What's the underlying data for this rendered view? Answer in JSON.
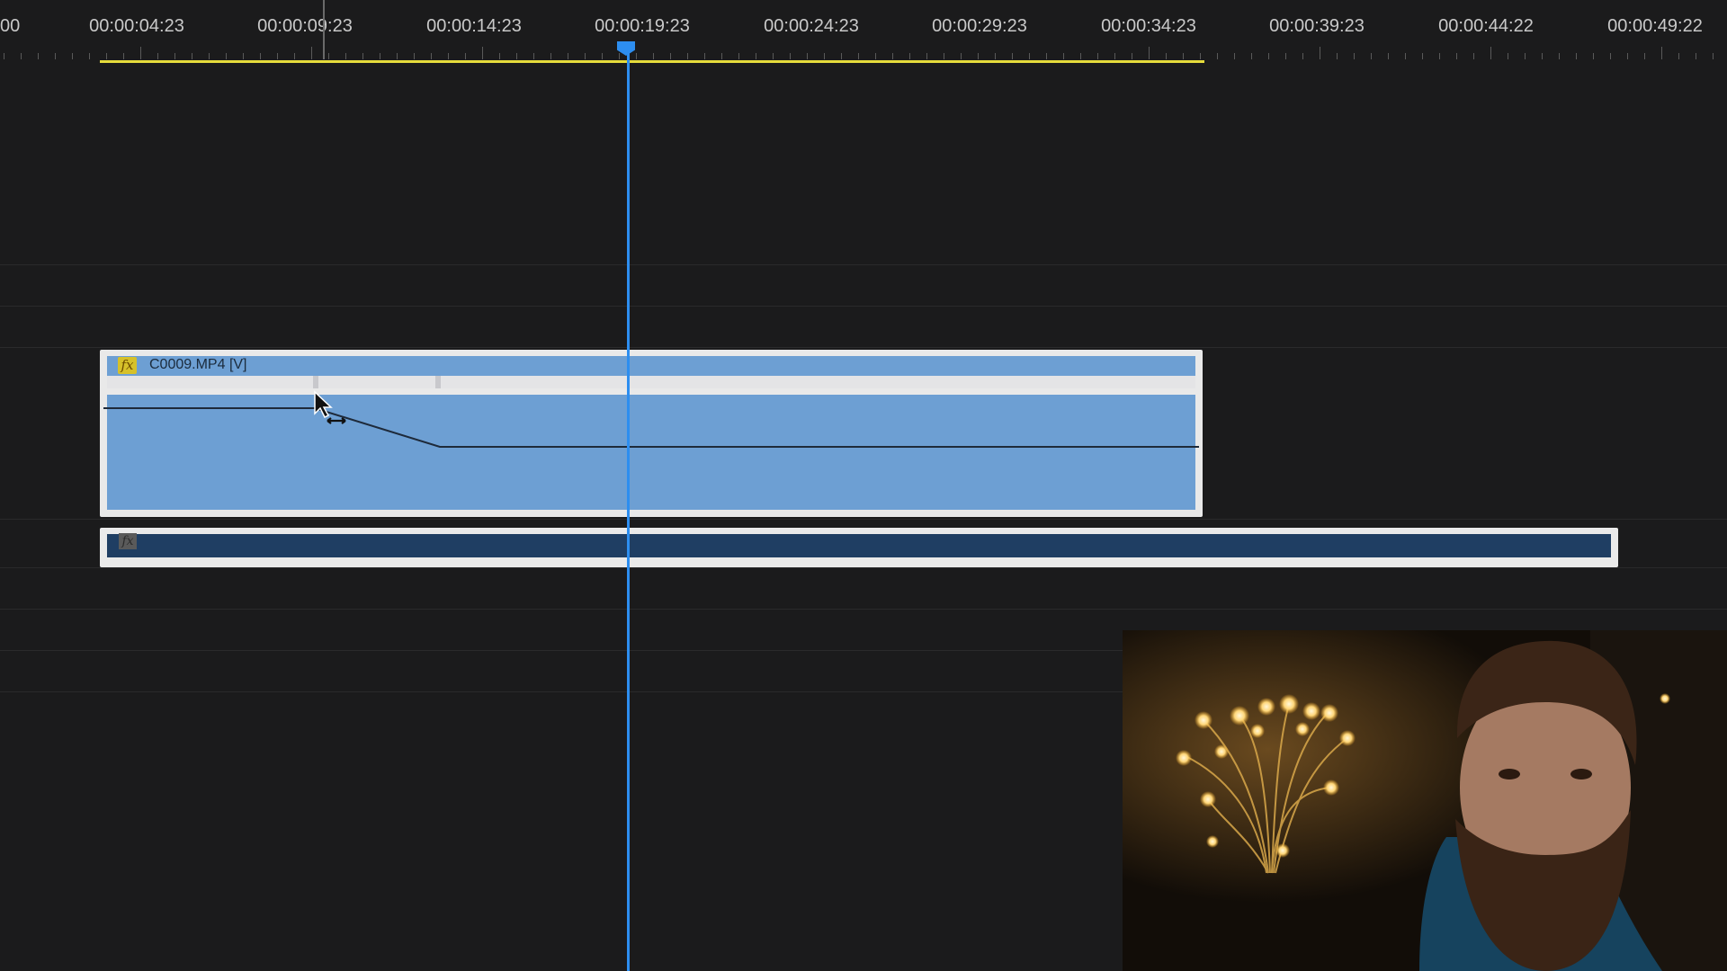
{
  "ruler": {
    "timecodes": [
      "00",
      "00:00:04:23",
      "00:00:09:23",
      "00:00:14:23",
      "00:00:19:23",
      "00:00:24:23",
      "00:00:29:23",
      "00:00:34:23",
      "00:00:39:23",
      "00:00:44:22",
      "00:00:49:22"
    ]
  },
  "playhead": {
    "timecode": "00:00:19:23"
  },
  "video_clip": {
    "fx_label": "fx",
    "name": "C0009.MP4 [V]"
  },
  "audio_clip": {
    "fx_label": "fx"
  },
  "colors": {
    "clip_video": "#6d9fd3",
    "clip_audio": "#1f3e63",
    "playhead": "#2d8ef0",
    "work_area": "#e6dc3c",
    "fx_badge": "#d6c12a"
  },
  "icons": {
    "cursor": "arrow-pointer-with-resize-icon"
  }
}
